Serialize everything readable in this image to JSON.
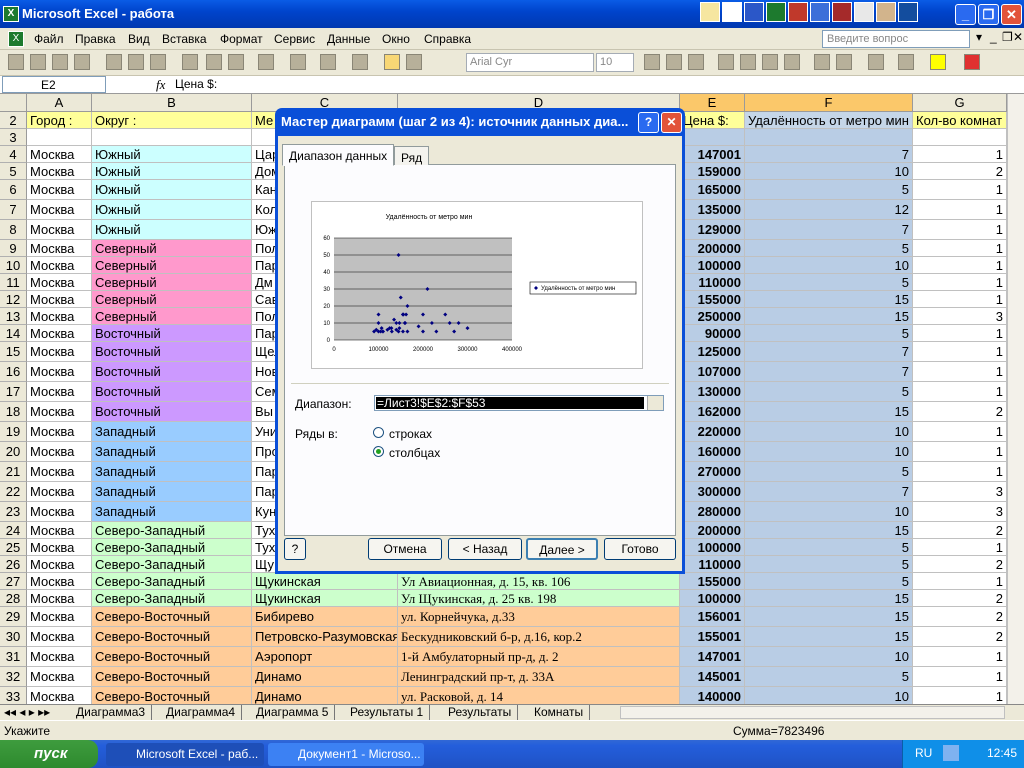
{
  "window": {
    "title": "Microsoft Excel - работа"
  },
  "menu": [
    "Файл",
    "Правка",
    "Вид",
    "Вставка",
    "Формат",
    "Сервис",
    "Данные",
    "Окно",
    "Справка"
  ],
  "help_placeholder": "Введите вопрос",
  "toolbar": {
    "font": "Arial Cyr",
    "size": "10"
  },
  "formula": {
    "name_box": "E2",
    "fx": "fx",
    "value": "Цена $:"
  },
  "columns": [
    "A",
    "B",
    "C",
    "D",
    "E",
    "F",
    "G"
  ],
  "header_row": {
    "row": "2",
    "a": "Город :",
    "b": "Округ :",
    "c": "Ме",
    "e": "Цена $:",
    "f": "Удалённость от метро мин",
    "g": "Кол-во комнат"
  },
  "rows": [
    {
      "r": "3",
      "a": "",
      "b": "",
      "c": "",
      "d": "",
      "e": "",
      "f": "",
      "g": ""
    },
    {
      "r": "4",
      "a": "Москва",
      "b": "Южный",
      "c": "Цар",
      "d": "",
      "e": "147001",
      "f": "7",
      "g": "1"
    },
    {
      "r": "5",
      "a": "Москва",
      "b": "Южный",
      "c": "Дом",
      "d": "",
      "e": "159000",
      "f": "10",
      "g": "2"
    },
    {
      "r": "6",
      "a": "Москва",
      "b": "Южный",
      "c": "Кан",
      "d": "",
      "e": "165000",
      "f": "5",
      "g": "1"
    },
    {
      "r": "7",
      "a": "Москва",
      "b": "Южный",
      "c": "Кол",
      "d": "",
      "e": "135000",
      "f": "12",
      "g": "1"
    },
    {
      "r": "8",
      "a": "Москва",
      "b": "Южный",
      "c": "Юж",
      "d": "",
      "e": "129000",
      "f": "7",
      "g": "1"
    },
    {
      "r": "9",
      "a": "Москва",
      "b": "Северный",
      "c": "Пол",
      "d": "",
      "e": "200000",
      "f": "5",
      "g": "1"
    },
    {
      "r": "10",
      "a": "Москва",
      "b": "Северный",
      "c": "Пар",
      "d": "",
      "e": "100000",
      "f": "10",
      "g": "1"
    },
    {
      "r": "11",
      "a": "Москва",
      "b": "Северный",
      "c": "Дм",
      "d": "",
      "e": "110000",
      "f": "5",
      "g": "1"
    },
    {
      "r": "12",
      "a": "Москва",
      "b": "Северный",
      "c": "Сав",
      "d": "",
      "e": "155000",
      "f": "15",
      "g": "1"
    },
    {
      "r": "13",
      "a": "Москва",
      "b": "Северный",
      "c": "Пол",
      "d": "",
      "e": "250000",
      "f": "15",
      "g": "3"
    },
    {
      "r": "14",
      "a": "Москва",
      "b": "Восточный",
      "c": "Пар",
      "d": "",
      "e": "90000",
      "f": "5",
      "g": "1"
    },
    {
      "r": "15",
      "a": "Москва",
      "b": "Восточный",
      "c": "Щел",
      "d": "",
      "e": "125000",
      "f": "7",
      "g": "1"
    },
    {
      "r": "16",
      "a": "Москва",
      "b": "Восточный",
      "c": "Нов",
      "d": "",
      "e": "107000",
      "f": "7",
      "g": "1"
    },
    {
      "r": "17",
      "a": "Москва",
      "b": "Восточный",
      "c": "Сем",
      "d": "",
      "e": "130000",
      "f": "5",
      "g": "1"
    },
    {
      "r": "18",
      "a": "Москва",
      "b": "Восточный",
      "c": "Вы",
      "d": "",
      "e": "162000",
      "f": "15",
      "g": "2"
    },
    {
      "r": "19",
      "a": "Москва",
      "b": "Западный",
      "c": "Уни",
      "d": "",
      "e": "220000",
      "f": "10",
      "g": "1"
    },
    {
      "r": "20",
      "a": "Москва",
      "b": "Западный",
      "c": "Про",
      "d": "",
      "e": "160000",
      "f": "10",
      "g": "1"
    },
    {
      "r": "21",
      "a": "Москва",
      "b": "Западный",
      "c": "Пар",
      "d": "",
      "e": "270000",
      "f": "5",
      "g": "1"
    },
    {
      "r": "22",
      "a": "Москва",
      "b": "Западный",
      "c": "Пар",
      "d": "",
      "e": "300000",
      "f": "7",
      "g": "3"
    },
    {
      "r": "23",
      "a": "Москва",
      "b": "Западный",
      "c": "Кун",
      "d": "",
      "e": "280000",
      "f": "10",
      "g": "3"
    },
    {
      "r": "24",
      "a": "Москва",
      "b": "Северо-Западный",
      "c": "Тух",
      "d": "",
      "e": "200000",
      "f": "15",
      "g": "2"
    },
    {
      "r": "25",
      "a": "Москва",
      "b": "Северо-Западный",
      "c": "Тух",
      "d": "",
      "e": "100000",
      "f": "5",
      "g": "1"
    },
    {
      "r": "26",
      "a": "Москва",
      "b": "Северо-Западный",
      "c": "Щу",
      "d": "",
      "e": "110000",
      "f": "5",
      "g": "2"
    },
    {
      "r": "27",
      "a": "Москва",
      "b": "Северо-Западный",
      "c": "Щукинская",
      "d": "Ул Авиационная, д. 15, кв. 106",
      "e": "155000",
      "f": "5",
      "g": "1"
    },
    {
      "r": "28",
      "a": "Москва",
      "b": "Северо-Западный",
      "c": "Щукинская",
      "d": "Ул Щукинская, д. 25 кв. 198",
      "e": "100000",
      "f": "15",
      "g": "2"
    },
    {
      "r": "29",
      "a": "Москва",
      "b": "Северо-Восточный",
      "c": "Бибирево",
      "d": "ул. Корнейчука, д.33",
      "e": "156001",
      "f": "15",
      "g": "2"
    },
    {
      "r": "30",
      "a": "Москва",
      "b": "Северо-Восточный",
      "c": "Петровско-Разумовская",
      "d": "Бескудниковский б-р, д.16, кор.2",
      "e": "155001",
      "f": "15",
      "g": "2"
    },
    {
      "r": "31",
      "a": "Москва",
      "b": "Северо-Восточный",
      "c": "Аэропорт",
      "d": "1-й Амбулаторный пр-д, д. 2",
      "e": "147001",
      "f": "10",
      "g": "1"
    },
    {
      "r": "32",
      "a": "Москва",
      "b": "Северо-Восточный",
      "c": "Динамо",
      "d": "Ленинградский пр-т, д. 33А",
      "e": "145001",
      "f": "5",
      "g": "1"
    },
    {
      "r": "33",
      "a": "Москва",
      "b": "Северо-Восточный",
      "c": "Динамо",
      "d": "ул. Расковой, д. 14",
      "e": "140000",
      "f": "10",
      "g": "1"
    }
  ],
  "colors": {
    "Южный": "#ccffff",
    "Северный": "#ff99cc",
    "Восточный": "#cc99ff",
    "Западный": "#99ccff",
    "Северо-Западный": "#ccffcc",
    "Северо-Восточный": "#ffcc99",
    "header": "#ffff99",
    "selected": "#b9cde5"
  },
  "sheets": [
    "Диаграмма3",
    "Диаграмма4",
    "Диаграмма 5",
    "Результаты 1",
    "Результаты",
    "Комнаты"
  ],
  "status": {
    "left": "Укажите",
    "sum": "Сумма=7823496"
  },
  "taskbar": {
    "start": "пуск",
    "tasks": [
      "Microsoft Excel - раб...",
      "Документ1 - Microso..."
    ],
    "lang": "RU",
    "time": "12:45"
  },
  "dialog": {
    "title": "Мастер диаграмм (шаг 2 из 4): источник данных диа...",
    "tabs": [
      "Диапазон данных",
      "Ряд"
    ],
    "range_label": "Диапазон:",
    "range_value": "=Лист3!$E$2:$F$53",
    "series_label": "Ряды в:",
    "opt_rows": "строках",
    "opt_cols": "столбцах",
    "buttons": {
      "cancel": "Отмена",
      "back": "< Назад",
      "next": "Далее >",
      "finish": "Готово"
    }
  },
  "chart_data": {
    "type": "scatter",
    "title": "Удалённость от метро мин",
    "legend": [
      "Удалённость от метро мин"
    ],
    "legend_position": "right",
    "xlim": [
      0,
      400000
    ],
    "ylim": [
      0,
      60
    ],
    "xticks": [
      "0",
      "100000",
      "200000",
      "300000",
      "400000"
    ],
    "yticks": [
      "0",
      "10",
      "20",
      "30",
      "40",
      "50",
      "60"
    ],
    "points": [
      [
        147001,
        7
      ],
      [
        159000,
        10
      ],
      [
        165000,
        5
      ],
      [
        135000,
        12
      ],
      [
        129000,
        7
      ],
      [
        200000,
        5
      ],
      [
        100000,
        10
      ],
      [
        110000,
        5
      ],
      [
        155000,
        15
      ],
      [
        250000,
        15
      ],
      [
        90000,
        5
      ],
      [
        125000,
        7
      ],
      [
        107000,
        7
      ],
      [
        130000,
        5
      ],
      [
        162000,
        15
      ],
      [
        220000,
        10
      ],
      [
        160000,
        10
      ],
      [
        270000,
        5
      ],
      [
        300000,
        7
      ],
      [
        280000,
        10
      ],
      [
        200000,
        15
      ],
      [
        100000,
        5
      ],
      [
        110000,
        5
      ],
      [
        155000,
        5
      ],
      [
        100000,
        15
      ],
      [
        156001,
        15
      ],
      [
        155001,
        15
      ],
      [
        147001,
        10
      ],
      [
        145001,
        5
      ],
      [
        140000,
        10
      ],
      [
        145000,
        50
      ],
      [
        150000,
        25
      ],
      [
        210000,
        30
      ],
      [
        190000,
        8
      ],
      [
        120000,
        6
      ],
      [
        165000,
        20
      ],
      [
        230000,
        5
      ],
      [
        260000,
        10
      ],
      [
        140000,
        6
      ],
      [
        105000,
        5
      ],
      [
        95000,
        6
      ]
    ]
  }
}
